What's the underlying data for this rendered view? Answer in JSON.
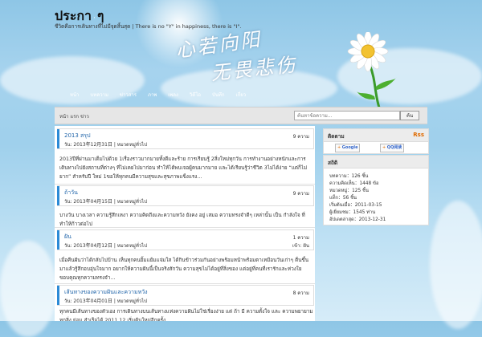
{
  "header": {
    "site_title": "ประกา",
    "title_separator": "·",
    "title_tail": "ๆ",
    "tagline": "ชีวิตคือการเดินทางที่ไม่มีจุดสิ้นสุด | There is no \"Y\" in happiness, there is \"I\".",
    "calligraphy_line1": "心若向阳",
    "calligraphy_line2": "无畏悲伤"
  },
  "nav": {
    "items": [
      "หน้า",
      "บทความ",
      "ข่าวสาร",
      "ภาพ",
      "เพลง",
      "วิดีโอ",
      "บันทึก",
      "เกี่ยว"
    ]
  },
  "bar": {
    "crumb": "หน้า แรก ข่าว",
    "search_placeholder": "ค้นหาข้อความ...",
    "search_button": "ค้น"
  },
  "posts": [
    {
      "title": "2013 สรุป",
      "count": "9 ความ",
      "meta": "วัน: 2013年12月31日 | หมวดหมู่ทั่วไป",
      "category": "",
      "body": "2013ปีที่ผ่านมาเต็มไปด้วย 1เรื่องราวมากมายทั้งดีและร้าย การเรียนรู้ 2สิ่งใหม่ทุกวัน การทำงานอย่างหนักและการเดินทางไปยังสถานที่ต่างๆ ที่ไม่เคยไปมาก่อน ทำให้ได้พบเจอผู้คนมากมาย และได้เรียนรู้ว่าชีวิต 3ไม่ได้ง่าย “แต่ก็ไม่ยาก” สำหรับปี ใหม่ 1ขอให้ทุกคนมีความสุขและสุขภาพแข็งแรง..."
    },
    {
      "title": "ถ้าวัน",
      "count": "9 ความ",
      "meta": "วัน: 2013年04月15日 | หมวดหมู่ทั่วไป",
      "category": "",
      "body": "บางวัน บางเวลา ความรู้สึกเหงา ความคิดถึงและความหวัง ยังคง อยู่ เสมอ ความทรงจำดีๆ เหล่านั้น เป็น กำลังใจ ที่ทำให้ก้าวต่อไป"
    },
    {
      "title": "ฝัน",
      "count": "1 ความ",
      "meta": "วัน: 2013年04月12日 | หมวดหมู่ทั่วไป",
      "category": "เข้า: ฝัน",
      "body": "เมื่อคืนฝันว่าได้กลับไปบ้าน เห็นทุกคนยิ้มแย้มแจ่มใส ได้กินข้าวร่วมกันอย่างพร้อมหน้าพร้อมตาเหมือนวันเก่าๆ ตื่นขึ้นมาแล้วรู้สึกอบอุ่นใจมาก อยากให้ความฝันนี้เป็นจริงสักวัน ความสุขไม่ได้อยู่ที่สิ่งของ แต่อยู่ที่คนที่เรารักและห่วงใย ขอบคุณทุกความทรงจำ..."
    },
    {
      "title": "เส้นทางของความฝันและความหวัง",
      "count": "8 ความ",
      "meta": "วัน: 2013年04月01日 | หมวดหมู่ทั่วไป",
      "category": "",
      "body": "ทุกคนมีเส้นทางของตัวเอง การเดินทางบนเส้นทางแห่งความฝันไม่ใช่เรื่องง่าย แต่ ถ้า มี ความตั้งใจ และ ความพยายาม ทุกสิ่ง ย่อม สำเร็จได้ 2011.12 เริ่มต้นใหม่อีกครั้ง"
    }
  ],
  "sidebar": {
    "subscribe": {
      "title": "ติดตาม",
      "rss_label": "Rss",
      "badge_google": "Google",
      "badge_qq": "QQ阅读"
    },
    "stats": {
      "title": "สถิติ",
      "lines": [
        "บทความ：126 ชิ้น",
        "ความคิดเห็น：1448 ข้อ",
        "หมวดหมู่：125 ชิ้น",
        "แท็ก：56 ชิ้น",
        "เริ่มต้นเมื่อ：2011-03-15",
        "ผู้เยี่ยมชม：1545 ท่าน",
        "อัปเดตล่าสุด：2013-12-31"
      ]
    }
  },
  "colors": {
    "link": "#2266aa",
    "accent": "#2b8ad6",
    "rss": "#e06a00"
  }
}
